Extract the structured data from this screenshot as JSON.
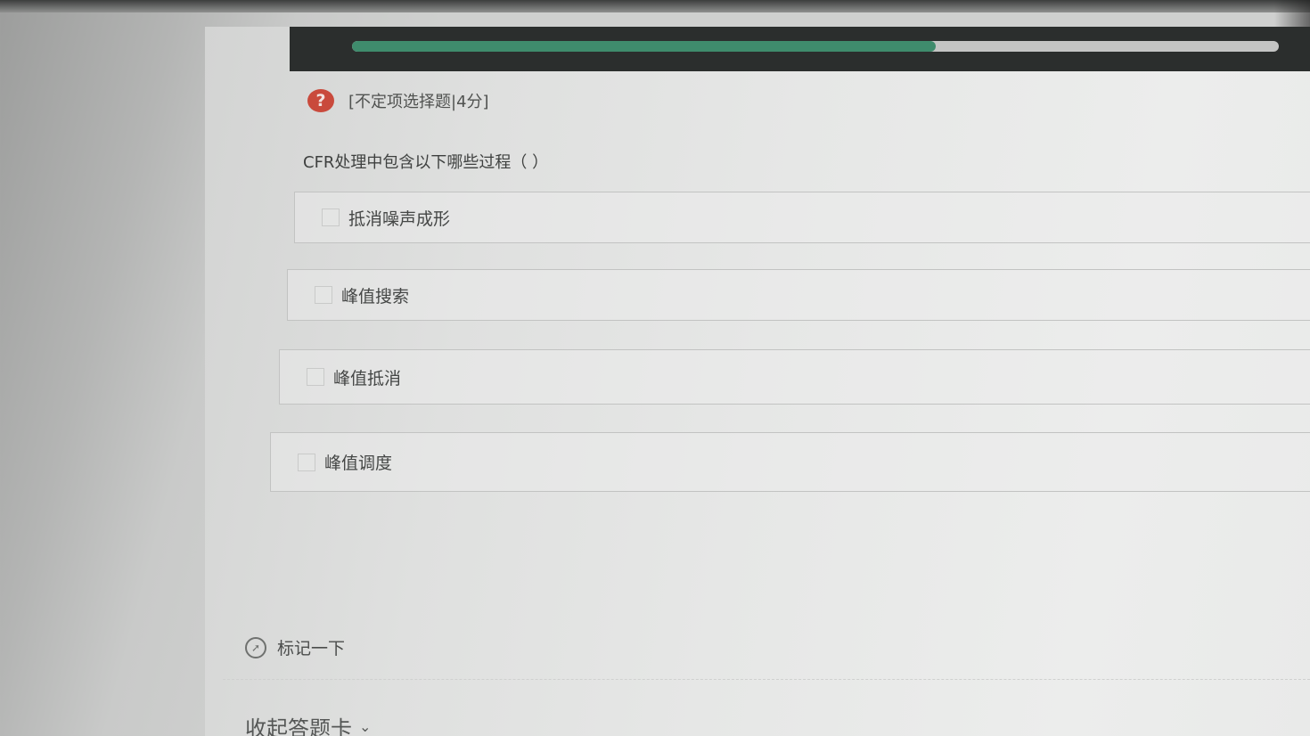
{
  "progress": {
    "percent": 63,
    "fill_color": "#3f8c6d",
    "track_color": "#c4c5c4",
    "bar_color": "#2b2e2d"
  },
  "question": {
    "icon": "question-circle-icon",
    "icon_glyph": "?",
    "icon_color": "#c94a3c",
    "type_label": "[不定项选择题|4分]",
    "stem": "CFR处理中包含以下哪些过程（    ）",
    "options": [
      {
        "label": "抵消噪声成形",
        "checked": false
      },
      {
        "label": "峰值搜索",
        "checked": false
      },
      {
        "label": "峰值抵消",
        "checked": false
      },
      {
        "label": "峰值调度",
        "checked": false
      }
    ]
  },
  "mark": {
    "icon": "flag-compass-icon",
    "label": "标记一下"
  },
  "answer_card": {
    "collapse_label": "收起答题卡",
    "chevron_icon": "chevron-down-icon"
  }
}
